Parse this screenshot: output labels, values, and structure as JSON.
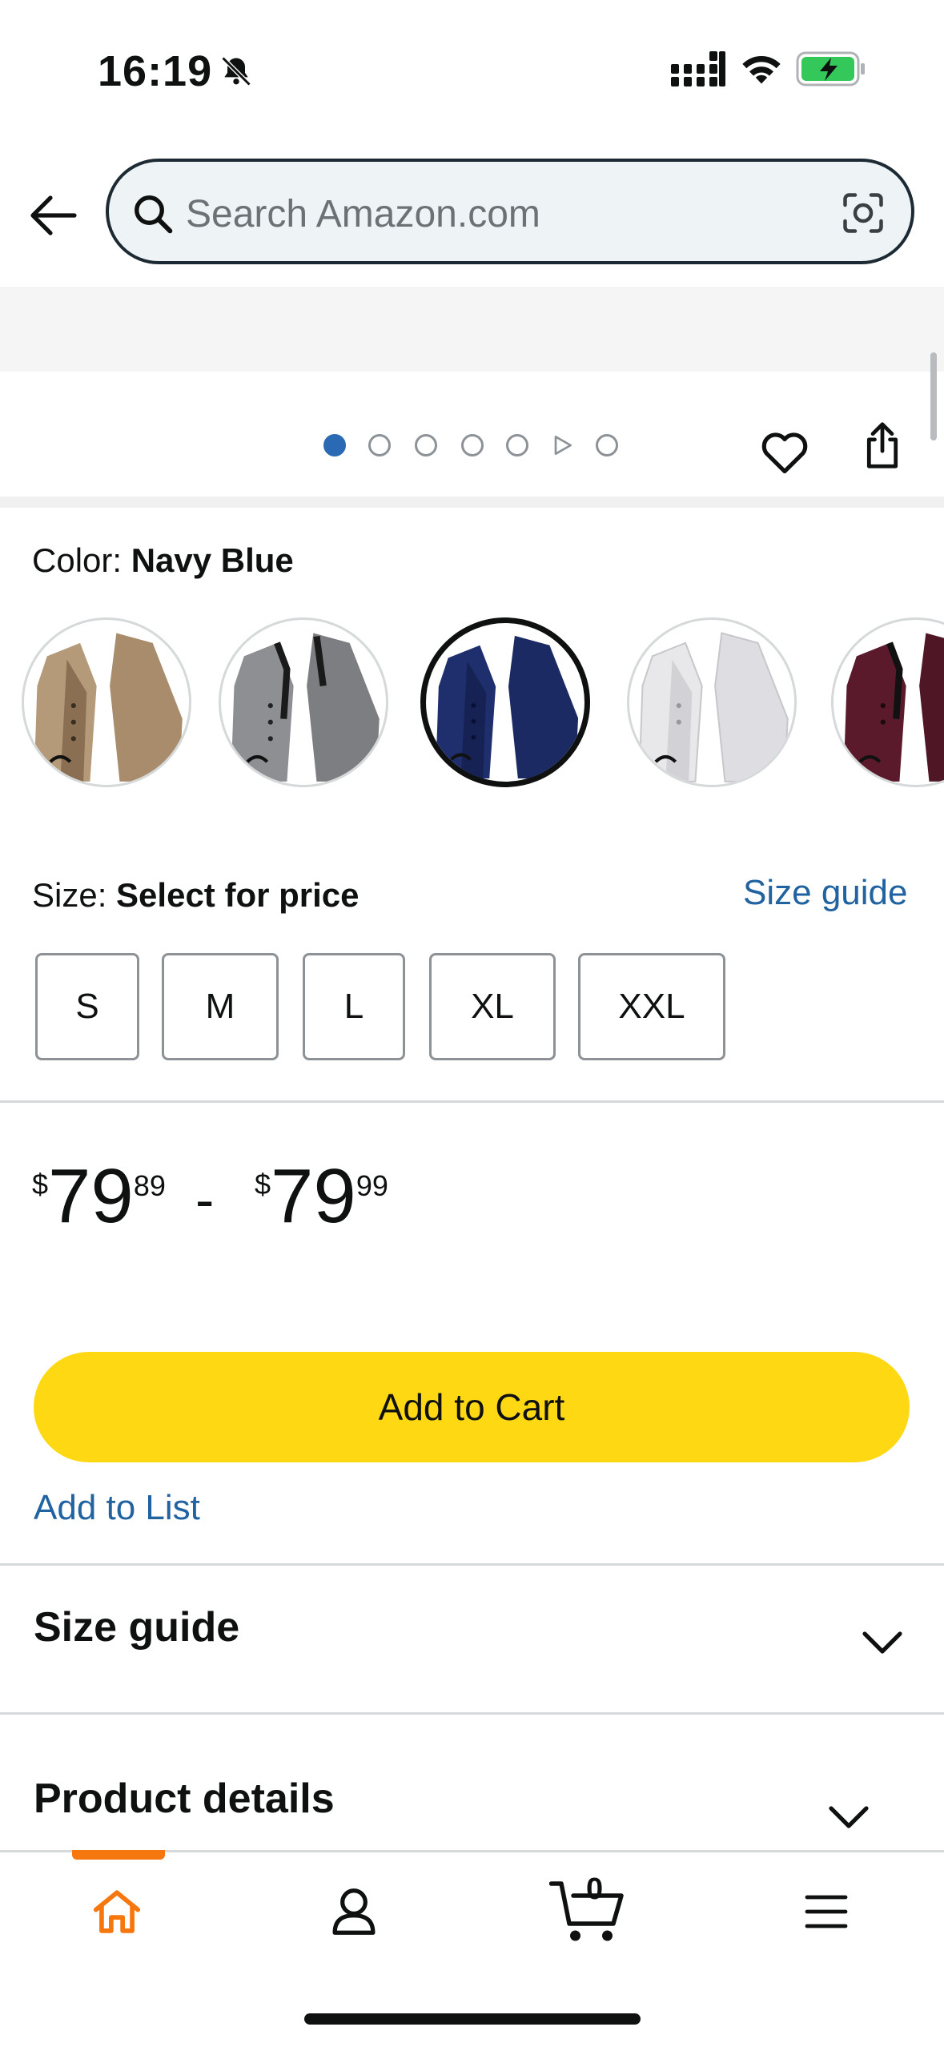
{
  "status_bar": {
    "time": "16:19",
    "icons": [
      "bell-slash-icon",
      "signal-icon",
      "wifi-icon",
      "battery-charging-icon"
    ]
  },
  "search": {
    "placeholder": "Search Amazon.com"
  },
  "gallery": {
    "dot_count": 7,
    "active_index": 0,
    "video_index": 5
  },
  "color": {
    "label": "Color: ",
    "value": "Navy Blue",
    "swatches": [
      {
        "name": "Khaki",
        "hex": "#b59a7a",
        "selected": false
      },
      {
        "name": "Gray",
        "hex": "#8e8f93",
        "selected": false
      },
      {
        "name": "Navy Blue",
        "hex": "#1f2f6e",
        "selected": true
      },
      {
        "name": "White",
        "hex": "#e8e8ea",
        "selected": false
      },
      {
        "name": "Burgundy",
        "hex": "#5a1a2c",
        "selected": false
      }
    ]
  },
  "size": {
    "label": "Size: ",
    "value": "Select for price",
    "guide_link": "Size guide",
    "options": [
      "S",
      "M",
      "L",
      "XL",
      "XXL"
    ]
  },
  "price": {
    "low": {
      "symbol": "$",
      "whole": "79",
      "fraction": "89"
    },
    "separator": "-",
    "high": {
      "symbol": "$",
      "whole": "79",
      "fraction": "99"
    }
  },
  "actions": {
    "add_to_cart": "Add to Cart",
    "add_to_list": "Add to List"
  },
  "sections": {
    "size_guide": "Size guide",
    "product_details": "Product details"
  },
  "bottom_nav": {
    "cart_count": "0",
    "accent": "#f7770f"
  },
  "colors": {
    "link": "#2162a1",
    "cart_button": "#ffd814",
    "active_dot": "#2a6ab4"
  }
}
